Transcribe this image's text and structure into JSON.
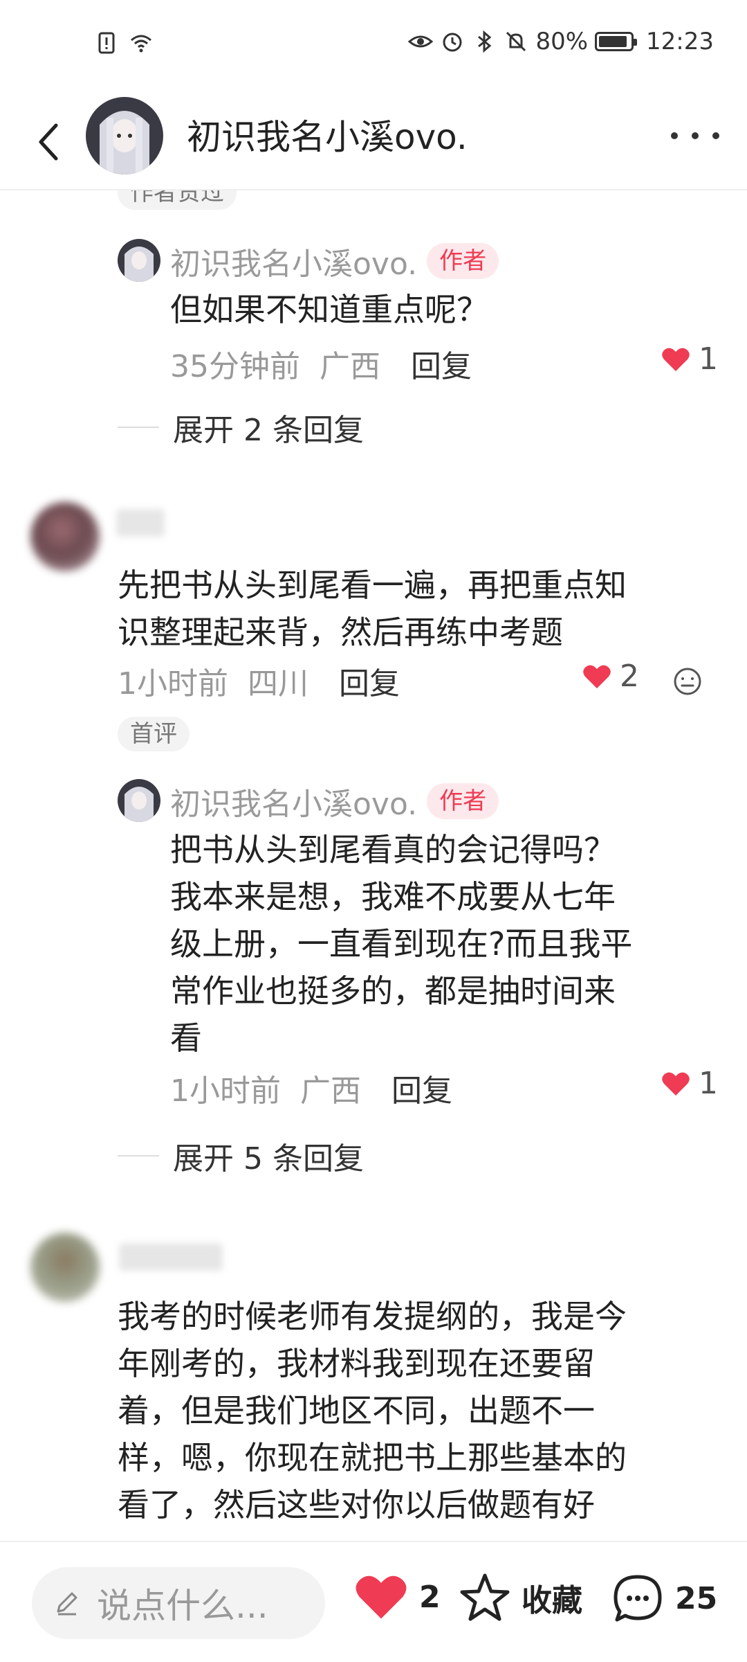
{
  "status_bar": {
    "battery": "80%",
    "time": "12:23",
    "battery_level": 0.8
  },
  "header": {
    "title": "初识我名小溪ovo."
  },
  "top_partial_tag": "作者赞过",
  "comments": [
    {
      "nickname": "初识我名小溪ovo.",
      "badge": "作者",
      "text": "但如果不知道重点呢？",
      "time": "35分钟前",
      "location": "广西",
      "reply_label": "回复",
      "likes": "1"
    },
    {
      "expand_label": "展开 2 条回复"
    },
    {
      "text_lines": [
        "先把书从头到尾看一遍，再把重点知",
        "识整理起来背，然后再练中考题"
      ],
      "time": "1小时前",
      "location": "四川",
      "reply_label": "回复",
      "likes": "2",
      "tag": "首评"
    },
    {
      "nickname": "初识我名小溪ovo.",
      "badge": "作者",
      "text_lines": [
        "把书从头到尾看真的会记得吗？",
        "我本来是想，我难不成要从七年",
        "级上册，一直看到现在?而且我平",
        "常作业也挺多的，都是抽时间来",
        "看"
      ],
      "time": "1小时前",
      "location": "广西",
      "reply_label": "回复",
      "likes": "1"
    },
    {
      "expand_label": "展开 5 条回复"
    },
    {
      "text_lines": [
        "我考的时候老师有发提纲的，我是今",
        "年刚考的，我材料我到现在还要留",
        "着，但是我们地区不同，出题不一",
        "样，嗯，你现在就把书上那些基本的",
        "看了，然后这些对你以后做题有好"
      ]
    }
  ],
  "bottom_bar": {
    "input_placeholder": "说点什么...",
    "like_count": "2",
    "collect_label": "收藏",
    "comment_count": "25"
  },
  "colors": {
    "accent": "#ef3b53",
    "badge_bg": "#fde9ec"
  }
}
